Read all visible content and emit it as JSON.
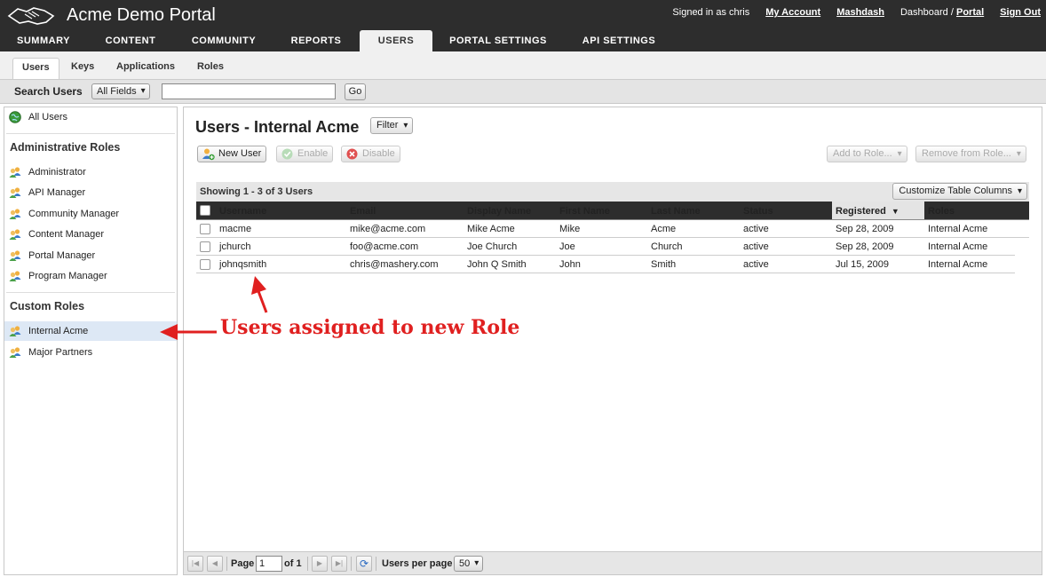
{
  "app": {
    "title": "Acme Demo Portal"
  },
  "topnav": {
    "signed_in": "Signed in as chris",
    "my_account": "My Account",
    "mashdash": "Mashdash",
    "dashboard_prefix": "Dashboard /",
    "portal": "Portal",
    "sign_out": "Sign Out"
  },
  "main_tabs": [
    "SUMMARY",
    "CONTENT",
    "COMMUNITY",
    "REPORTS",
    "USERS",
    "PORTAL SETTINGS",
    "API SETTINGS"
  ],
  "active_main_tab": "USERS",
  "sub_tabs": [
    "Users",
    "Keys",
    "Applications",
    "Roles"
  ],
  "search": {
    "label": "Search Users",
    "field_select": "All Fields",
    "value": "",
    "go_label": "Go"
  },
  "sidebar": {
    "all_users": "All Users",
    "admin_heading": "Administrative Roles",
    "admin_roles": [
      "Administrator",
      "API Manager",
      "Community Manager",
      "Content Manager",
      "Portal Manager",
      "Program Manager"
    ],
    "custom_heading": "Custom Roles",
    "custom_roles": [
      "Internal Acme",
      "Major Partners"
    ],
    "selected": "Internal Acme"
  },
  "main": {
    "title": "Users - Internal Acme",
    "filter_label": "Filter",
    "new_user": "New User",
    "enable": "Enable",
    "disable": "Disable",
    "add_to_role": "Add to Role...",
    "remove_from_role": "Remove from Role...",
    "showing": "Showing 1 - 3 of 3 Users",
    "customize_columns": "Customize Table Columns"
  },
  "table": {
    "columns": [
      "Username",
      "Email",
      "Display Name",
      "First Name",
      "Last Name",
      "Status",
      "Registered",
      "Roles"
    ],
    "sorted_column": "Registered",
    "rows": [
      [
        "macme",
        "mike@acme.com",
        "Mike Acme",
        "Mike",
        "Acme",
        "active",
        "Sep 28, 2009",
        "Internal Acme"
      ],
      [
        "jchurch",
        "foo@acme.com",
        "Joe Church",
        "Joe",
        "Church",
        "active",
        "Sep 28, 2009",
        "Internal Acme"
      ],
      [
        "johnqsmith",
        "chris@mashery.com",
        "John Q Smith",
        "John",
        "Smith",
        "active",
        "Jul 15, 2009",
        "Internal Acme"
      ]
    ]
  },
  "pager": {
    "page_label": "Page",
    "page_value": "1",
    "of_label": "of 1",
    "per_page_label": "Users per page",
    "per_page_value": "50"
  },
  "annotation": {
    "text": "Users assigned to new Role",
    "color": "#e02020"
  },
  "colors": {
    "header_bg": "#2d2d2d",
    "selected_row": "#dde8f5",
    "annotation": "#e02020"
  }
}
